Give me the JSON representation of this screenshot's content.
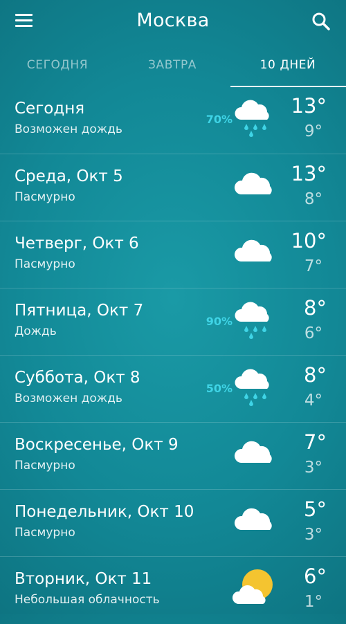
{
  "header": {
    "title": "Москва",
    "menu_icon": "menu-icon",
    "search_icon": "search-icon"
  },
  "tabs": [
    {
      "label": "СЕГОДНЯ",
      "active": false
    },
    {
      "label": "ЗАВТРА",
      "active": false
    },
    {
      "label": "10 ДНЕЙ",
      "active": true
    }
  ],
  "colors": {
    "precip_text": "#3fd4e6",
    "sun": "#f4c430",
    "background": "#128896"
  },
  "days": [
    {
      "day": "Сегодня",
      "condition": "Возможен дождь",
      "precip": "70%",
      "icon": "cloud-rain-icon",
      "high": "13°",
      "low": "9°"
    },
    {
      "day": "Среда, Окт 5",
      "condition": "Пасмурно",
      "precip": "",
      "icon": "cloud-icon",
      "high": "13°",
      "low": "8°"
    },
    {
      "day": "Четверг, Окт 6",
      "condition": "Пасмурно",
      "precip": "",
      "icon": "cloud-icon",
      "high": "10°",
      "low": "7°"
    },
    {
      "day": "Пятница, Окт 7",
      "condition": "Дождь",
      "precip": "90%",
      "icon": "cloud-rain-icon",
      "high": "8°",
      "low": "6°"
    },
    {
      "day": "Суббота, Окт 8",
      "condition": "Возможен дождь",
      "precip": "50%",
      "icon": "cloud-rain-icon",
      "high": "8°",
      "low": "4°"
    },
    {
      "day": "Воскресенье, Окт 9",
      "condition": "Пасмурно",
      "precip": "",
      "icon": "cloud-icon",
      "high": "7°",
      "low": "3°"
    },
    {
      "day": "Понедельник, Окт 10",
      "condition": "Пасмурно",
      "precip": "",
      "icon": "cloud-icon",
      "high": "5°",
      "low": "3°"
    },
    {
      "day": "Вторник, Окт 11",
      "condition": "Небольшая облачность",
      "precip": "",
      "icon": "partly-cloudy-icon",
      "high": "6°",
      "low": "1°"
    }
  ]
}
